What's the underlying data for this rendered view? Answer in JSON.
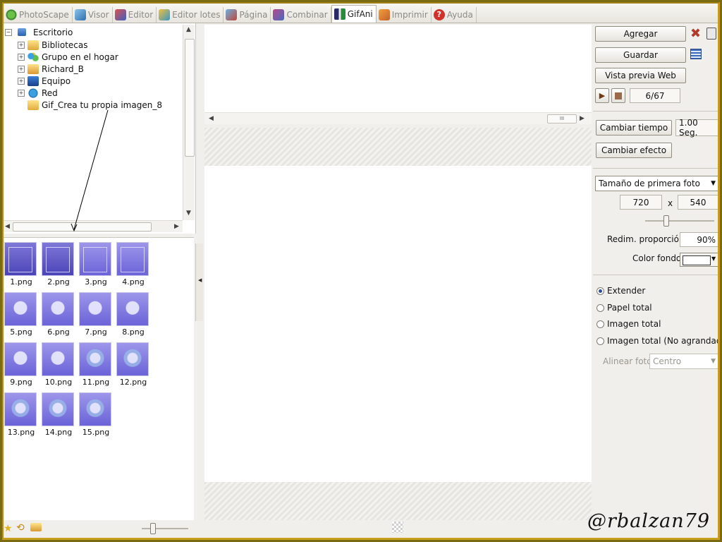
{
  "tabs": [
    {
      "label": "PhotoScape",
      "color": "#4a9a3a"
    },
    {
      "label": "Visor",
      "color": "#3a7fb8"
    },
    {
      "label": "Editor",
      "color": "#4d6bbf"
    },
    {
      "label": "Editor lotes",
      "color": "#3c95c4"
    },
    {
      "label": "Página",
      "color": "#c0473a"
    },
    {
      "label": "Combinar",
      "color": "#b54a8a"
    },
    {
      "label": "GifAni",
      "color": "#2a8a3a",
      "active": true
    },
    {
      "label": "Imprimir",
      "color": "#c6612a"
    },
    {
      "label": "Ayuda",
      "color": "#d2302a"
    }
  ],
  "tree": {
    "root": "Escritorio",
    "items": [
      "Bibliotecas",
      "Grupo en el hogar",
      "Richard_B",
      "Equipo",
      "Red",
      "Gif_Crea tu propia imagen_8"
    ]
  },
  "thumbnails": [
    "1.png",
    "2.png",
    "3.png",
    "4.png",
    "5.png",
    "6.png",
    "7.png",
    "8.png",
    "9.png",
    "10.png",
    "11.png",
    "12.png",
    "13.png",
    "14.png",
    "15.png"
  ],
  "right": {
    "add_label": "Agregar",
    "save_label": "Guardar",
    "preview_web_label": "Vista previa Web",
    "frame_counter": "6/67",
    "change_time_label": "Cambiar tiempo",
    "time_value": "1.00 Seg.",
    "change_effect_label": "Cambiar efecto",
    "size_select": "Tamaño de primera foto",
    "width": "720",
    "times": "x",
    "height": "540",
    "resize_label": "Redim. proporción",
    "resize_value": "90%",
    "bg_color_label": "Color fondo",
    "radios": [
      "Extender",
      "Papel total",
      "Imagen total",
      "Imagen total (No agrandada)"
    ],
    "align_label": "Alinear foto",
    "align_value": "Centro"
  },
  "watermark": "@rbalzan79"
}
